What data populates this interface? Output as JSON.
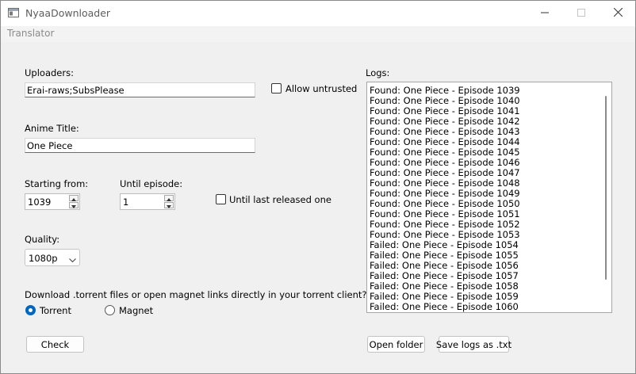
{
  "window": {
    "title": "NyaaDownloader"
  },
  "menu": {
    "translator": "Translator"
  },
  "form": {
    "uploaders_label": "Uploaders:",
    "uploaders_value": "Erai-raws;SubsPlease",
    "allow_untrusted_label": "Allow untrusted",
    "allow_untrusted_checked": false,
    "anime_title_label": "Anime Title:",
    "anime_title_value": "One Piece",
    "starting_from_label": "Starting from:",
    "starting_from_value": "1039",
    "until_episode_label": "Until episode:",
    "until_episode_value": "1",
    "until_last_label": "Until last released one",
    "until_last_checked": false,
    "quality_label": "Quality:",
    "quality_value": "1080p",
    "download_question": "Download .torrent files or open magnet links directly in your torrent client?",
    "torrent_label": "Torrent",
    "magnet_label": "Magnet",
    "selected_mode": "Torrent",
    "check_button": "Check"
  },
  "logs": {
    "label": "Logs:",
    "lines": [
      "Found: One Piece - Episode 1039",
      "Found: One Piece - Episode 1040",
      "Found: One Piece - Episode 1041",
      "Found: One Piece - Episode 1042",
      "Found: One Piece - Episode 1043",
      "Found: One Piece - Episode 1044",
      "Found: One Piece - Episode 1045",
      "Found: One Piece - Episode 1046",
      "Found: One Piece - Episode 1047",
      "Found: One Piece - Episode 1048",
      "Found: One Piece - Episode 1049",
      "Found: One Piece - Episode 1050",
      "Found: One Piece - Episode 1051",
      "Found: One Piece - Episode 1052",
      "Found: One Piece - Episode 1053",
      "Failed: One Piece - Episode 1054",
      "Failed: One Piece - Episode 1055",
      "Failed: One Piece - Episode 1056",
      "Failed: One Piece - Episode 1057",
      "Failed: One Piece - Episode 1058",
      "Failed: One Piece - Episode 1059",
      "Failed: One Piece - Episode 1060"
    ],
    "open_folder_button": "Open folder",
    "save_logs_button": "Save logs as .txt"
  },
  "colors": {
    "accent": "#0067c0"
  },
  "icons": [
    "app-icon",
    "minimize-icon",
    "maximize-icon",
    "close-icon",
    "spin-up-icon",
    "spin-down-icon",
    "chevron-down-icon"
  ]
}
